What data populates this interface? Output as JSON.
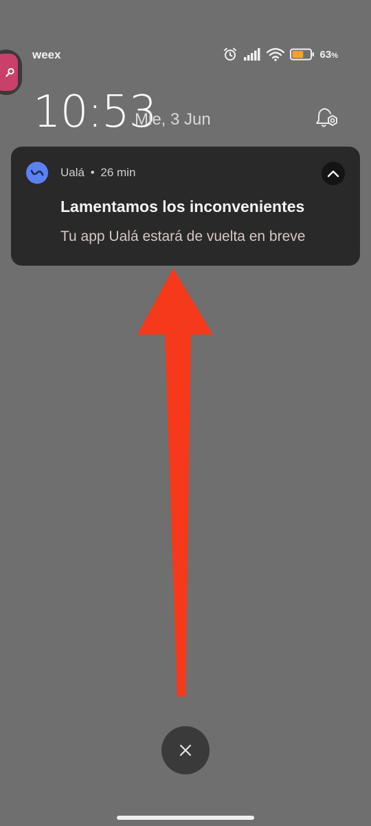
{
  "status_bar": {
    "carrier": "weex",
    "battery_percent": "63",
    "battery_percent_sign": "%",
    "battery_level": 0.63,
    "icons": [
      "alarm-icon",
      "signal-icon",
      "wifi-icon",
      "battery-icon"
    ]
  },
  "lockscreen": {
    "time": "10:53",
    "date": "Mie, 3 Jun"
  },
  "notification": {
    "app_name": "Ualá",
    "separator": "•",
    "time_ago": "26 min",
    "title": "Lamentamos los inconvenientes",
    "body": "Tu app Ualá estará de vuelta en breve",
    "app_color": "#5b81f4"
  },
  "overlay": {
    "arrow_color": "#f5391a",
    "bubble_color": "#c9416b"
  }
}
